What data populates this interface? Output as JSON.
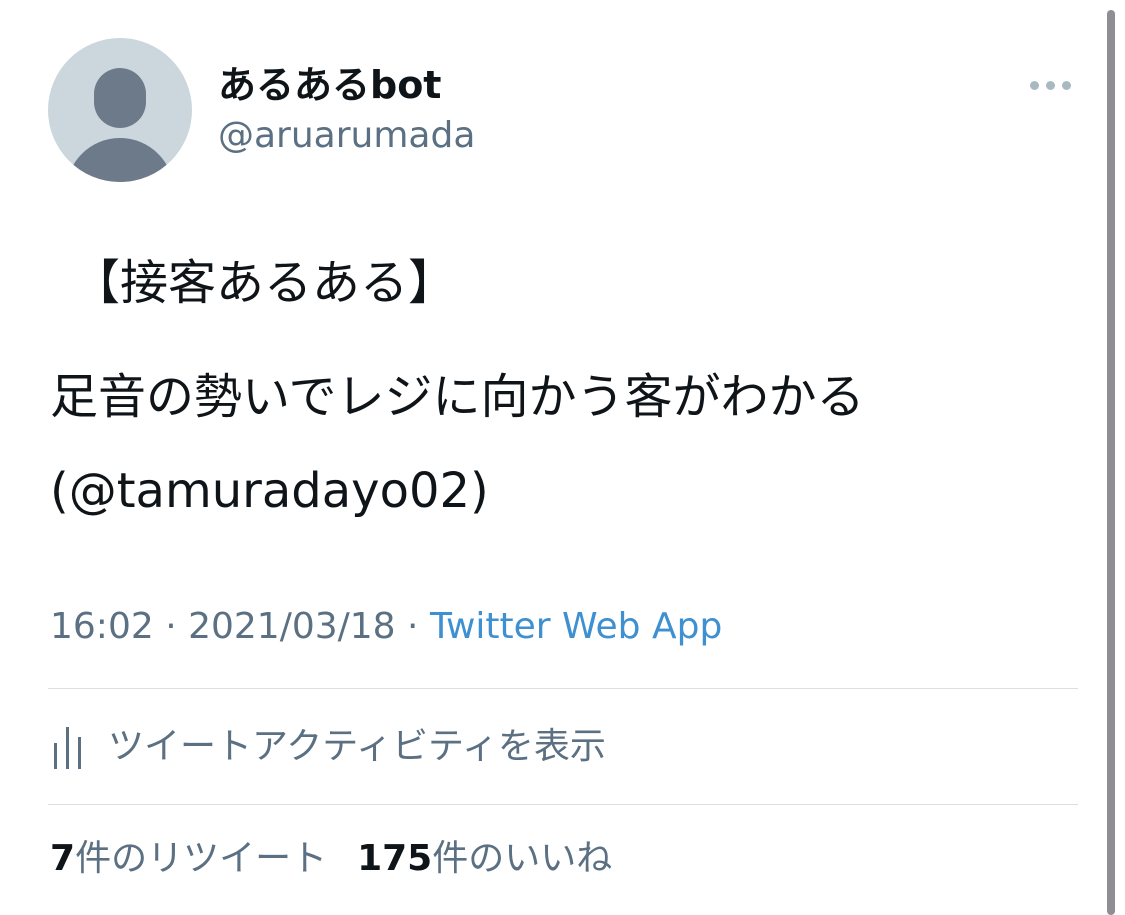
{
  "user": {
    "display_name": "あるあるbot",
    "handle": "@aruarumada"
  },
  "menu": {
    "icon": "more-dots-icon"
  },
  "tweet": {
    "line1": "【接客あるある】",
    "line2": "足音の勢いでレジに向かう客がわかる",
    "line3": "(@tamuradayo02)"
  },
  "meta": {
    "time": "16:02",
    "separator": " · ",
    "date": "2021/03/18",
    "source": "Twitter Web App"
  },
  "activity": {
    "icon": "bar-chart-icon",
    "label": "ツイートアクティビティを表示"
  },
  "stats": {
    "retweet_count": "7",
    "retweet_label": "件のリツイート",
    "like_count": "175",
    "like_label": "件のいいね"
  },
  "colors": {
    "text_primary": "#0f1419",
    "text_secondary": "#5b7083",
    "link": "#3e90d0",
    "avatar_bg": "#ccd6dd",
    "avatar_fg": "#6c7a89",
    "divider": "#dadfe3"
  }
}
